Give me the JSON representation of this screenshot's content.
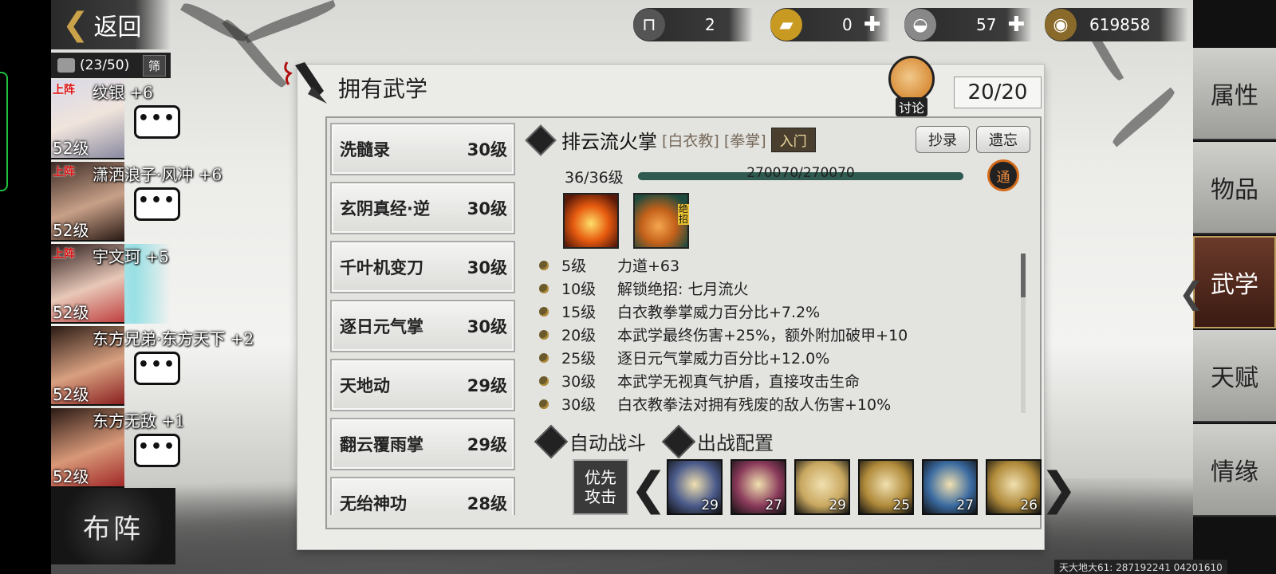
{
  "nav": {
    "back_label": "返回"
  },
  "roster": {
    "count": "(23/50)",
    "filter_label": "筛"
  },
  "characters": [
    {
      "name": "纹银",
      "bonus": "+6",
      "level": "52级",
      "deployed": "上阵",
      "bubble": "•••"
    },
    {
      "name": "潇洒浪子·风冲",
      "bonus": "+6",
      "level": "52级",
      "deployed": "上阵",
      "bubble": "•••"
    },
    {
      "name": "宇文珂",
      "bonus": "+5",
      "level": "52级",
      "deployed": "上阵",
      "bubble": ""
    },
    {
      "name": "东方兄弟·东方天下",
      "bonus": "+2",
      "level": "52级",
      "deployed": "",
      "bubble": "•••"
    },
    {
      "name": "东方无敌",
      "bonus": "+1",
      "level": "52级",
      "deployed": "",
      "bubble": "•••"
    }
  ],
  "formation_label": "布阵",
  "currencies": [
    {
      "icon": "bed-icon",
      "value": "2",
      "plus": false
    },
    {
      "icon": "gold-bar-icon",
      "value": "0",
      "plus": true
    },
    {
      "icon": "silver-ingot-icon",
      "value": "57",
      "plus": true
    },
    {
      "icon": "coin-icon",
      "value": "619858",
      "plus": false
    }
  ],
  "panel": {
    "title": "拥有武学",
    "discuss_label": "讨论",
    "count": "20/20"
  },
  "skills": [
    {
      "name": "洗髓录",
      "level": "30级"
    },
    {
      "name": "玄阴真经·逆",
      "level": "30级"
    },
    {
      "name": "千叶机变刀",
      "level": "30级"
    },
    {
      "name": "逐日元气掌",
      "level": "30级"
    },
    {
      "name": "天地动",
      "level": "29级"
    },
    {
      "name": "翻云覆雨掌",
      "level": "29级"
    },
    {
      "name": "无绐神功",
      "level": "28级"
    }
  ],
  "detail": {
    "name": "排云流火掌",
    "sect_tag": "[白衣教]",
    "type_tag": "[拳掌]",
    "rank_tag": "入门",
    "copy_label": "抄录",
    "forget_label": "遗忘",
    "level_text": "36/36级",
    "xp_text": "270070/270070",
    "xp_fraction": 1.0,
    "mastery_badge": "通",
    "ult_badge": "绝招",
    "perks": [
      {
        "level": "5级",
        "text": "力道+63"
      },
      {
        "level": "10级",
        "text": "解锁绝招:   七月流火"
      },
      {
        "level": "15级",
        "text": "白衣教拳掌威力百分比+7.2%"
      },
      {
        "level": "20级",
        "text": "本武学最终伤害+25%，额外附加破甲+10"
      },
      {
        "level": "25级",
        "text": "逐日元气掌威力百分比+12.0%"
      },
      {
        "level": "30级",
        "text": "本武学无视真气护盾，直接攻击生命"
      },
      {
        "level": "30级",
        "text": "白衣教拳法对拥有残废的敌人伤害+10%"
      }
    ]
  },
  "battle": {
    "auto_label": "自动战斗",
    "config_label": "出战配置",
    "priority_label_1": "优先",
    "priority_label_2": "攻击",
    "slots": [
      {
        "num": "29",
        "color": "#4a5a8a"
      },
      {
        "num": "27",
        "color": "#8a3a5a"
      },
      {
        "num": "29",
        "color": "#c9a860"
      },
      {
        "num": "25",
        "color": "#b08a3a"
      },
      {
        "num": "27",
        "color": "#3a6aa0"
      },
      {
        "num": "26",
        "color": "#b08a3a"
      }
    ]
  },
  "side_menu": [
    {
      "label": "属性",
      "active": false
    },
    {
      "label": "物品",
      "active": false
    },
    {
      "label": "武学",
      "active": true
    },
    {
      "label": "天赋",
      "active": false
    },
    {
      "label": "情缘",
      "active": false
    }
  ],
  "footer_id": "天大地大61: 287192241  04201610"
}
